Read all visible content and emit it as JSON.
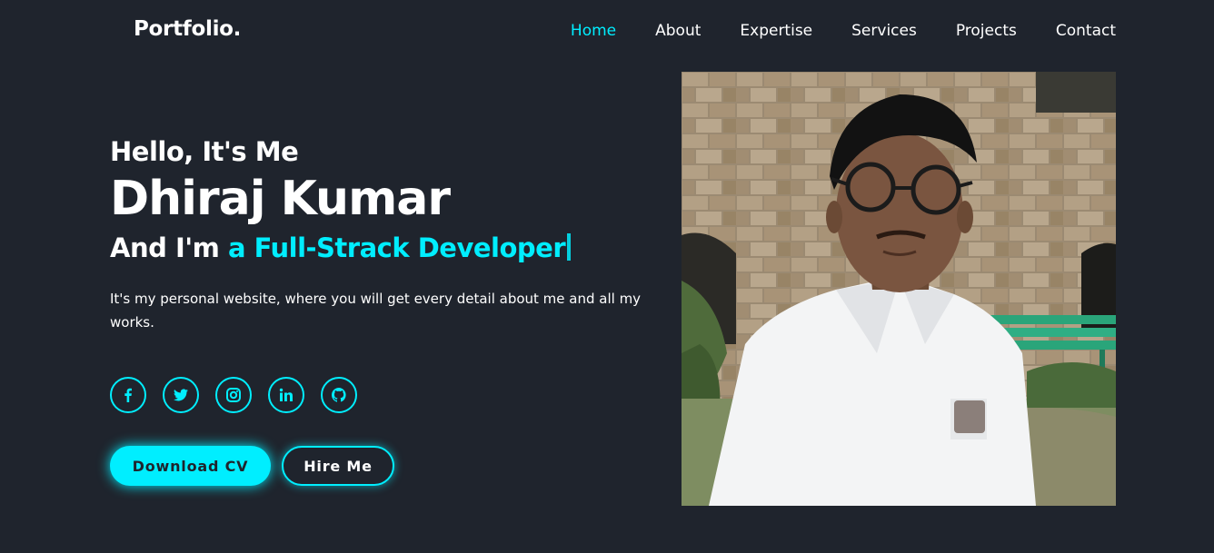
{
  "header": {
    "logo": "Portfolio.",
    "nav": [
      {
        "label": "Home",
        "active": true
      },
      {
        "label": "About"
      },
      {
        "label": "Expertise"
      },
      {
        "label": "Services"
      },
      {
        "label": "Projects"
      },
      {
        "label": "Contact"
      }
    ]
  },
  "hero": {
    "greeting": "Hello, It's Me",
    "name": "Dhiraj Kumar",
    "role_prefix": "And I'm",
    "role_highlight": "a Full-Strack Developer",
    "description": "It's my personal website, where you will get every detail about me and all my works."
  },
  "social": [
    "facebook-icon",
    "twitter-icon",
    "instagram-icon",
    "linkedin-icon",
    "github-icon"
  ],
  "buttons": {
    "download_cv": "Download CV",
    "hire_me": "Hire Me"
  },
  "colors": {
    "background": "#1f242d",
    "accent": "#00eeff",
    "text": "#ffffff"
  }
}
